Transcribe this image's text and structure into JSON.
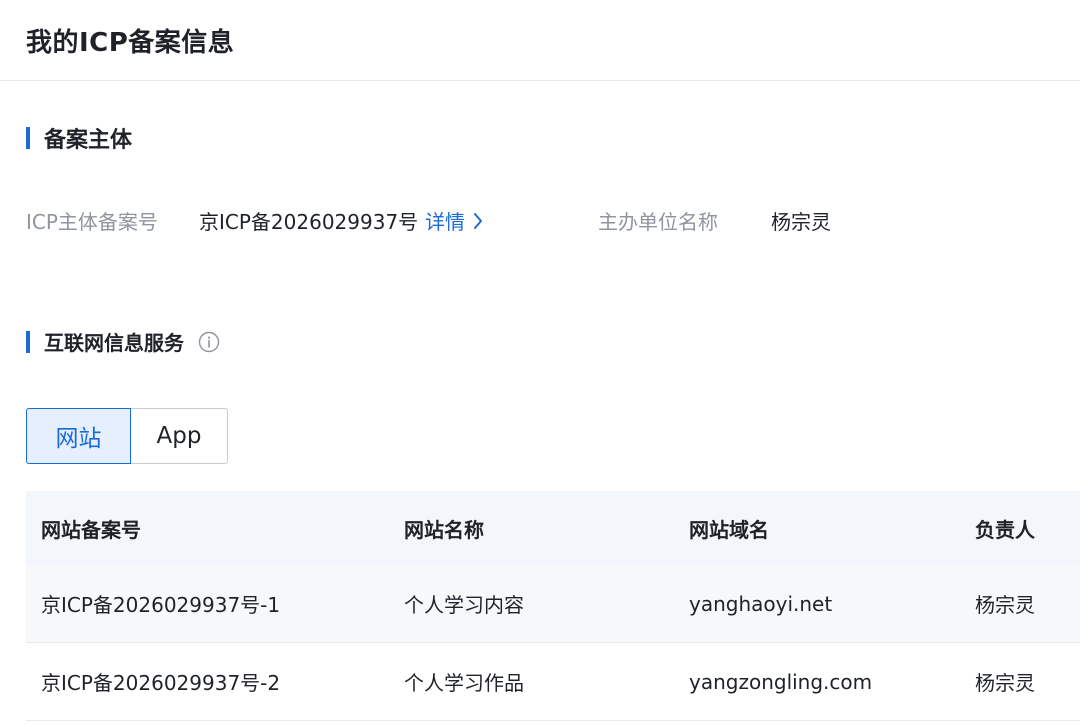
{
  "header": {
    "title": "我的ICP备案信息"
  },
  "subject_section": {
    "title": "备案主体",
    "icp_label": "ICP主体备案号",
    "icp_value": "京ICP备2026029937号",
    "detail_link": "详情",
    "org_label": "主办单位名称",
    "org_value": "杨宗灵"
  },
  "service_section": {
    "title": "互联网信息服务",
    "info_icon": "info-circle-icon"
  },
  "tabs": {
    "items": [
      {
        "label": "网站",
        "active": true
      },
      {
        "label": "App",
        "active": false
      }
    ]
  },
  "table": {
    "columns": [
      "网站备案号",
      "网站名称",
      "网站域名",
      "负责人"
    ],
    "rows": [
      [
        "京ICP备2026029937号-1",
        "个人学习内容",
        "yanghaoyi.net",
        "杨宗灵"
      ],
      [
        "京ICP备2026029937号-2",
        "个人学习作品",
        "yangzongling.com",
        "杨宗灵"
      ]
    ]
  },
  "colors": {
    "accent": "#1a6bd8",
    "table_header_bg": "#f3f6fb",
    "label_gray": "#8f959e"
  }
}
